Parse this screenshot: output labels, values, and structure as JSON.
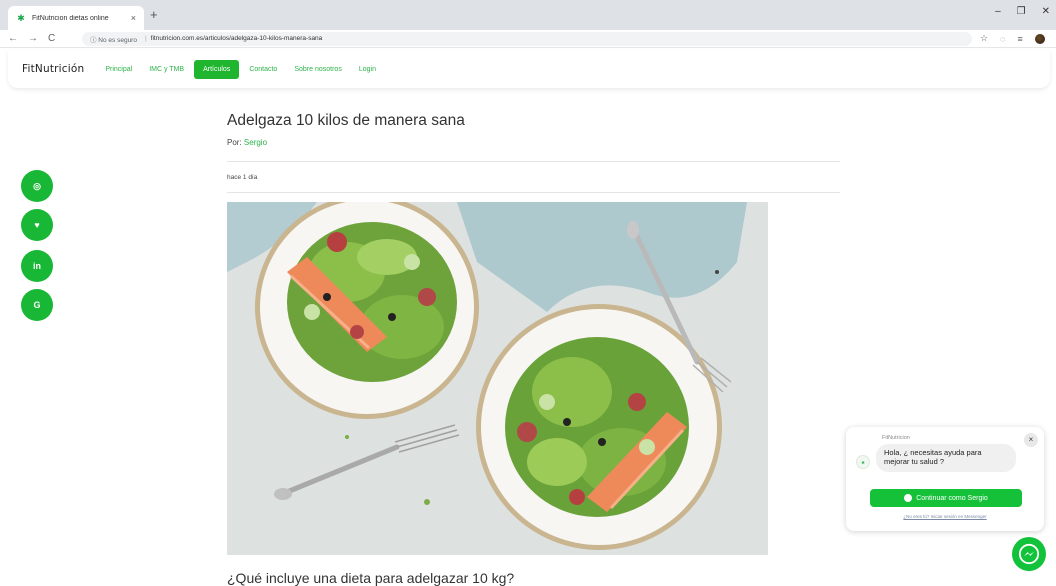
{
  "browser": {
    "tab_title": "FitNutricion dietas online",
    "tab_close": "×",
    "new_tab": "+",
    "win_minimize": "–",
    "win_restore": "❐",
    "win_close": "✕",
    "nav_back": "←",
    "nav_forward": "→",
    "nav_reload": "C",
    "insecure_label": "ⓘ No es seguro",
    "domain": "fitnutricion.com.es",
    "path": "/articulos/adelgaza-10-kilos-manera-sana"
  },
  "site": {
    "brand": "FitNutrición",
    "nav": [
      {
        "label": "Principal"
      },
      {
        "label": "IMC y TMB"
      },
      {
        "label": "Artículos"
      },
      {
        "label": "Contacto"
      },
      {
        "label": "Sobre nosotros"
      },
      {
        "label": "Login"
      }
    ],
    "active_nav": "Artículos",
    "brand_color": "#1fb52e"
  },
  "social": [
    {
      "icon": "instagram-icon",
      "glyph": "◎"
    },
    {
      "icon": "twitter-icon",
      "glyph": "♥"
    },
    {
      "icon": "linkedin-icon",
      "glyph": "in"
    },
    {
      "icon": "google-icon",
      "glyph": "G"
    }
  ],
  "article": {
    "title": "Adelgaza 10 kilos de manera sana",
    "by_label": "Por:",
    "author": "Sergio",
    "date": "hace 1 día",
    "next_heading": "¿Qué incluye una dieta para adelgazar 10 kg?"
  },
  "chat": {
    "page_name": "FitNutricion",
    "message": "Hola, ¿ necesitas ayuda para mejorar tu salud ?",
    "cta": "Continuar como Sergio",
    "not_you": "¿No eres tú? Iniciar sesión en Messenger",
    "close": "×"
  }
}
